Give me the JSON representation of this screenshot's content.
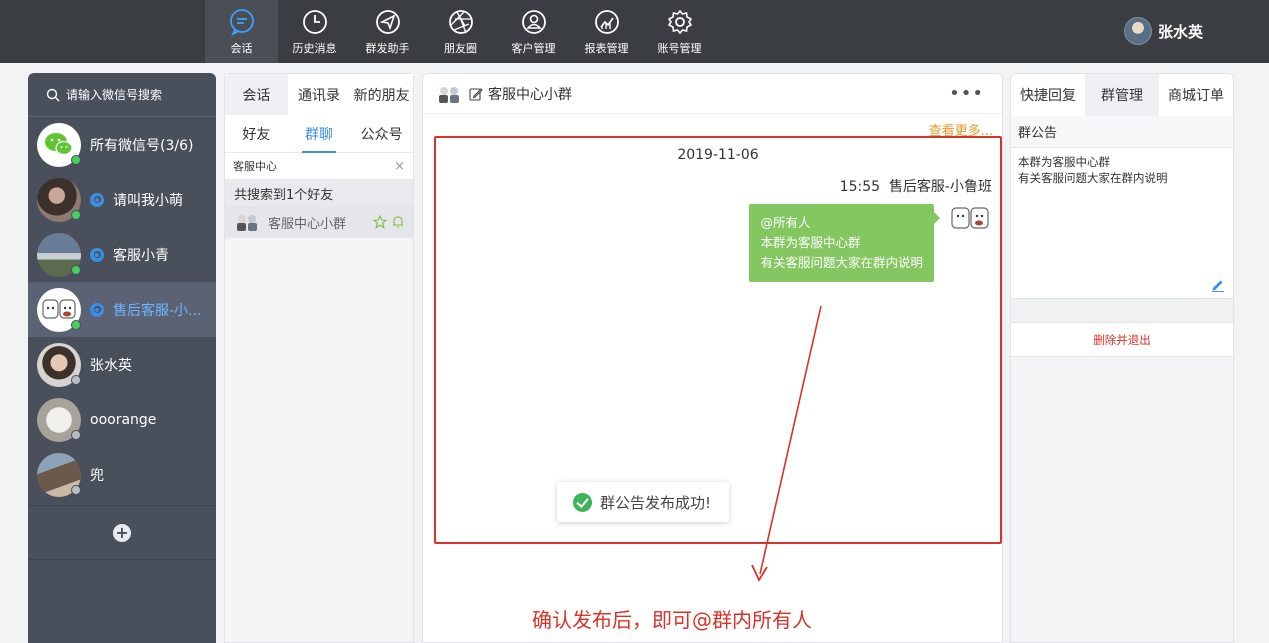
{
  "nav": {
    "items": [
      {
        "label": "会话",
        "icon": "chat-icon",
        "active": true
      },
      {
        "label": "历史消息",
        "icon": "clock-icon"
      },
      {
        "label": "群发助手",
        "icon": "send-icon"
      },
      {
        "label": "朋友圈",
        "icon": "aperture-icon"
      },
      {
        "label": "客户管理",
        "icon": "customer-icon"
      },
      {
        "label": "报表管理",
        "icon": "report-icon"
      },
      {
        "label": "账号管理",
        "icon": "gear-icon"
      }
    ],
    "user_name": "张水英"
  },
  "accounts": {
    "search_placeholder": "请输入微信号搜索",
    "items": [
      {
        "name": "所有微信号(3/6)",
        "status": "online"
      },
      {
        "name": "请叫我小萌",
        "status": "online"
      },
      {
        "name": "客服小青",
        "status": "online"
      },
      {
        "name": "售后客服-小...",
        "status": "online",
        "active": true
      },
      {
        "name": "张水英",
        "status": "offline"
      },
      {
        "name": "ooorange",
        "status": "offline"
      },
      {
        "name": "兜",
        "status": "offline"
      }
    ],
    "add_label": "+"
  },
  "contacts": {
    "tabs": [
      "会话",
      "通讯录",
      "新的朋友"
    ],
    "subtabs": [
      "好友",
      "群聊",
      "公众号"
    ],
    "filter_value": "客服中心",
    "result_text": "共搜索到1个好友",
    "group_name": "客服中心小群"
  },
  "chat": {
    "title": "客服中心小群",
    "more": "•••",
    "see_more": "查看更多...",
    "date": "2019-11-06",
    "time": "15:55",
    "sender": "售后客服-小鲁班",
    "message_lines": [
      "@所有人",
      "本群为客服中心群",
      "有关客服问题大家在群内说明"
    ],
    "toast": "群公告发布成功!",
    "caption": "确认发布后，即可@群内所有人"
  },
  "right": {
    "tabs": [
      "快捷回复",
      "群管理",
      "商城订单"
    ],
    "announcement_title": "群公告",
    "announcement_lines": [
      "本群为客服中心群",
      "有关客服问题大家在群内说明"
    ],
    "quit_label": "删除并退出"
  },
  "colors": {
    "accent": "#3a8ee6",
    "bubble": "#84c761",
    "annotation_red": "#d8332a",
    "online": "#44d05a"
  }
}
